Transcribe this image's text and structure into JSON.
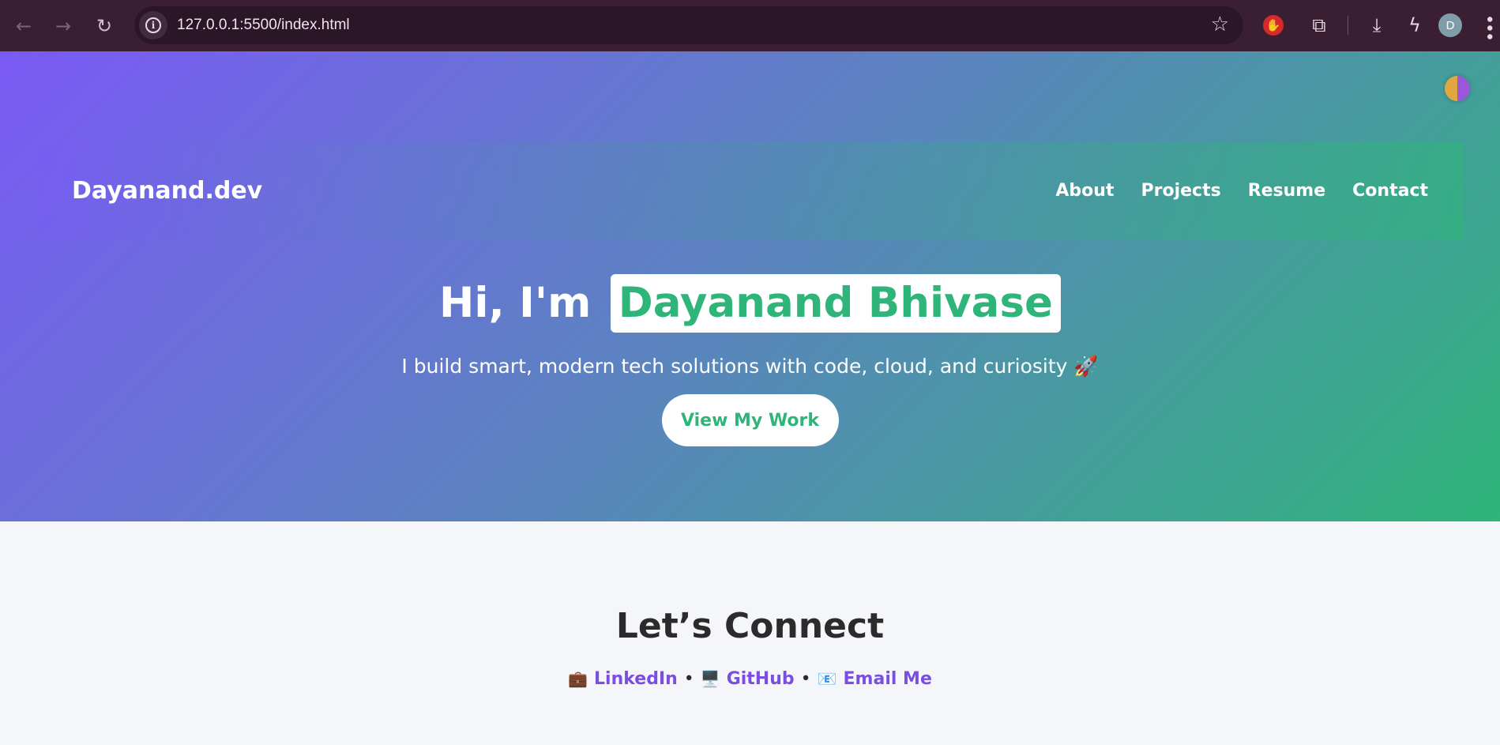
{
  "browser": {
    "url": "127.0.0.1:5500/index.html",
    "profile_initial": "D",
    "icons": {
      "back": "arrow-left",
      "forward": "arrow-right",
      "reload": "reload",
      "site_info": "info",
      "bookmark": "star",
      "extension_block": "red-hand",
      "extensions": "puzzle",
      "downloads": "download",
      "performance": "lightning",
      "menu": "kebab"
    }
  },
  "site": {
    "brand": "Dayanand.dev",
    "nav": [
      "About",
      "Projects",
      "Resume",
      "Contact"
    ],
    "hero": {
      "greeting": "Hi, I'm",
      "name": "Dayanand Bhivase",
      "subtitle": "I build smart, modern tech solutions with code, cloud, and curiosity 🚀",
      "cta": "View My Work"
    },
    "connect": {
      "title": "Let’s Connect",
      "links": [
        {
          "emoji": "💼",
          "label": "LinkedIn"
        },
        {
          "emoji": "🖥️",
          "label": "GitHub"
        },
        {
          "emoji": "📧",
          "label": "Email Me"
        }
      ],
      "separator": "•"
    }
  },
  "colors": {
    "accent_green": "#2fb57a",
    "accent_purple": "#7a5af5",
    "link_purple": "#7a4fe0",
    "chrome_bg": "#3a1f33"
  }
}
